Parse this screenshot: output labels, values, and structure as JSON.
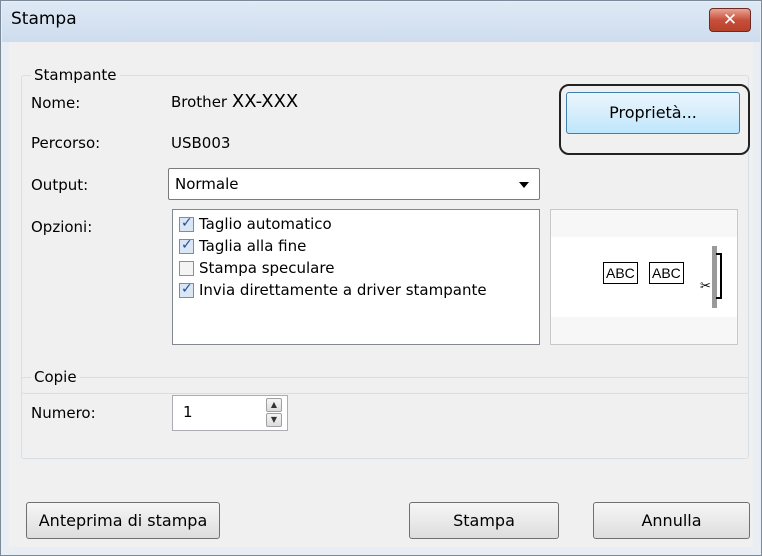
{
  "window": {
    "title": "Stampa",
    "close_symbol": "✕"
  },
  "printer_group": {
    "legend": "Stampante",
    "name_label": "Nome:",
    "name_value_prefix": "Brother",
    "name_value_model": "XX-XXX",
    "path_label": "Percorso:",
    "path_value": "USB003",
    "properties_button": "Proprietà..."
  },
  "output": {
    "label": "Output:",
    "selected": "Normale"
  },
  "options": {
    "label": "Opzioni:",
    "items": [
      {
        "label": "Taglio automatico",
        "checked": true
      },
      {
        "label": "Taglia alla fine",
        "checked": true
      },
      {
        "label": "Stampa speculare",
        "checked": false
      },
      {
        "label": "Invia direttamente a driver stampante",
        "checked": true
      }
    ]
  },
  "preview": {
    "label_1": "ABC",
    "label_2": "ABC",
    "cut_symbol": "✂"
  },
  "copies_group": {
    "legend": "Copie",
    "number_label": "Numero:",
    "number_value": "1"
  },
  "buttons": {
    "print_preview": "Anteprima di stampa",
    "print": "Stampa",
    "cancel": "Annulla"
  }
}
